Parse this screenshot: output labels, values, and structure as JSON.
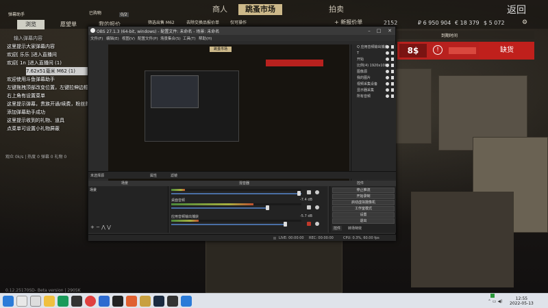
{
  "game": {
    "title_left": "弹幕助手",
    "tabs": [
      "商人",
      "跳蚤市场",
      "拍卖"
    ],
    "back_label": "返回",
    "currency": [
      "2152",
      "₽ 6 950 904",
      "€ 18 379",
      "$ 5 072"
    ],
    "inventory_tab": "浏览",
    "left_tabs": [
      "愿望单",
      "我的报价"
    ],
    "right_header": "到期时间",
    "add_offer": "+ 新报价单",
    "price": "8$",
    "out_of_stock": "缺货",
    "cart_label": "已购物",
    "center_label": "0/2",
    "filter_labels": [
      "筛选出售 M62",
      "去除交换品报价单",
      "仅可操作"
    ]
  },
  "danmaku": {
    "title": "弹幕助手",
    "header": "输入弹幕内容",
    "messages": [
      "这里提示大家弹幕内容",
      "欢迎[ 乐乐 ]进入直播间",
      "欢迎[ 1n ]进入直播间 (1)",
      "7.62x51毫米 M62 (1)",
      "欢迎使用斗鱼弹幕助手",
      "左键拖拽顶部改变位置，左键拉伸边框改变大小",
      "右上角有设置菜单",
      "这里提示弹幕，贵族开通/续费，粉丝牌升级等",
      "添加弹幕助手成功",
      "这里提示收到的礼物、道具",
      "点菜单可设置小礼物屏蔽"
    ],
    "footer": "观众 0k/s  | 热度 0  弹幕 0  礼物 0",
    "watermark": "0.12.25170SD- Beta version  | 2905K"
  },
  "obs": {
    "title": "OBS 27.1.3 (64-bit, windows) - 配置文件: 未命名 - 场景: 未命名",
    "menus": [
      "文件(F)",
      "编辑(E)",
      "视图(V)",
      "配置文件(P)",
      "场景集合(S)",
      "工具(T)",
      "帮助(H)"
    ],
    "sources": [
      "Q 应用音频输出捕获",
      "T",
      "开始",
      "比例(4) 1920x1080",
      "图像源",
      "我的图片",
      "视频采集设备",
      "显示器采集",
      "所有音频"
    ],
    "no_source": "未选择源",
    "props_label": "属性",
    "filters_label": "滤镜",
    "panel_headers": [
      "场景",
      "来源",
      "混音器",
      "转场",
      "控件"
    ],
    "scene_item": "场景",
    "mixer_tracks": [
      {
        "name": "应用音频输出",
        "db": "0.0 dB"
      },
      {
        "name": "桌面音频",
        "db": "-7.4 dB"
      },
      {
        "name": "应用音频输出捕获",
        "db": "-5.7 dB"
      }
    ],
    "controls": [
      "停止推流",
      "开始录制",
      "启动虚拟摄像机",
      "工作室模式",
      "设置",
      "退出"
    ],
    "controls_tabs": [
      "控件",
      "转场特效"
    ],
    "status": {
      "live": "LIVE: 00:00:00",
      "rec": "REC: 00:00:00",
      "cpu": "CPU: 0.3%, 60.00 fps"
    }
  },
  "taskbar": {
    "time": "12:55",
    "date": "2022-05-13"
  }
}
